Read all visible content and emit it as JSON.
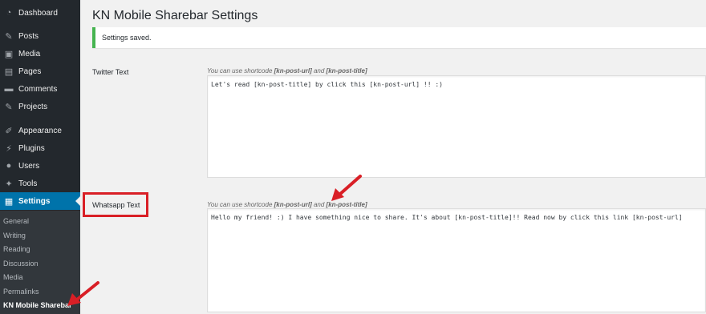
{
  "sidebar": {
    "items": [
      {
        "label": "Dashboard",
        "icon": "dashboard-icon"
      },
      {
        "label": "Posts",
        "icon": "pin-icon"
      },
      {
        "label": "Media",
        "icon": "media-icon"
      },
      {
        "label": "Pages",
        "icon": "pages-icon"
      },
      {
        "label": "Comments",
        "icon": "comments-icon"
      },
      {
        "label": "Projects",
        "icon": "pin-icon"
      },
      {
        "label": "Appearance",
        "icon": "brush-icon"
      },
      {
        "label": "Plugins",
        "icon": "plug-icon"
      },
      {
        "label": "Users",
        "icon": "user-icon"
      },
      {
        "label": "Tools",
        "icon": "wrench-icon"
      },
      {
        "label": "Settings",
        "icon": "settings-icon"
      }
    ],
    "submenu": [
      {
        "label": "General"
      },
      {
        "label": "Writing"
      },
      {
        "label": "Reading"
      },
      {
        "label": "Discussion"
      },
      {
        "label": "Media"
      },
      {
        "label": "Permalinks"
      },
      {
        "label": "KN Mobile Sharebar"
      }
    ]
  },
  "page": {
    "title": "KN Mobile Sharebar Settings",
    "notice": "Settings saved."
  },
  "fields": [
    {
      "label": "Twitter Text",
      "hint_prefix": "You can use shortcode ",
      "hint_code1": "[kn-post-url]",
      "hint_and": " and ",
      "hint_code2": "[kn-post-title]",
      "value": "Let's read [kn-post-title] by click this [kn-post-url] !! :)"
    },
    {
      "label": "Whatsapp Text",
      "hint_prefix": "You can use shortcode ",
      "hint_code1": "[kn-post-url]",
      "hint_and": " and ",
      "hint_code2": "[kn-post-title]",
      "value": "Hello my friend! :) I have something nice to share. It's about [kn-post-title]!! Read now by click this link [kn-post-url]"
    }
  ],
  "colors": {
    "sidebar_bg": "#23282d",
    "active_bg": "#0073aa",
    "notice_border": "#46b450",
    "highlight": "#d91f26"
  }
}
